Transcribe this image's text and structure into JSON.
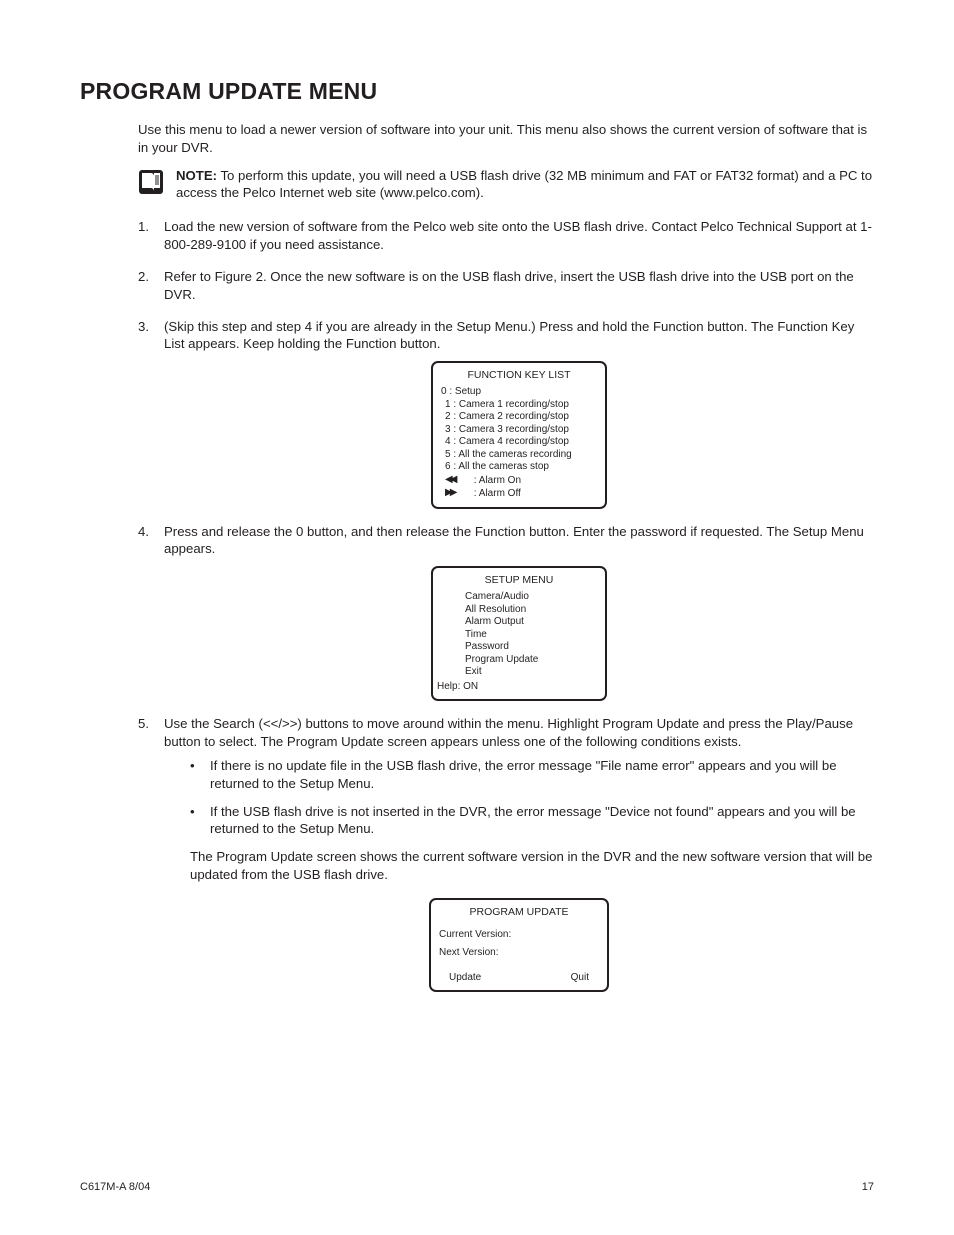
{
  "heading": "PROGRAM UPDATE MENU",
  "intro": "Use this menu to load a newer version of software into your unit. This menu also shows the current version of software that is in your DVR.",
  "note": {
    "label": "NOTE:",
    "text": "  To perform this update, you will need a USB flash drive (32 MB minimum and FAT or FAT32 format) and a PC to access the Pelco Internet web site (www.pelco.com)."
  },
  "steps": {
    "s1": "Load the new version of software from the Pelco web site onto the USB flash drive. Contact Pelco Technical Support at 1-800-289-9100 if you need assistance.",
    "s2": "Refer to Figure 2. Once the new software is on the USB flash drive, insert the USB flash drive into the USB port on the DVR.",
    "s3": "(Skip this step and step 4 if you are already in the Setup Menu.) Press and hold the Function button. The Function Key List appears. Keep holding the Function button.",
    "s4": "Press and release the 0 button, and then release the Function button. Enter the password if requested. The Setup Menu appears.",
    "s5": "Use the Search (<</>>) buttons to move around within the menu. Highlight Program Update and press the Play/Pause button to select. The Program Update screen appears unless one of the following conditions exists.",
    "s5_b1": "If there is no update file in the USB flash drive, the error message \"File name error\" appears and you will be returned to the Setup Menu.",
    "s5_b2": "If the USB flash drive is not inserted in the DVR, the error message \"Device not found\" appears and you will be returned to the Setup Menu.",
    "s5_after": "The Program Update screen shows the current software version in the DVR and the new software version that will be updated from the USB flash drive."
  },
  "panel1": {
    "title": "FUNCTION KEY LIST",
    "l0": "0 : Setup",
    "l1": "1 : Camera 1 recording/stop",
    "l2": "2 : Camera 2 recording/stop",
    "l3": "3 : Camera 3 recording/stop",
    "l4": "4 : Camera 4 recording/stop",
    "l5": "5 : All the cameras recording",
    "l6": "6 : All the cameras stop",
    "l7": " : Alarm On",
    "l8": " : Alarm Off"
  },
  "panel2": {
    "title": "SETUP MENU",
    "l0": "Camera/Audio",
    "l1": "All Resolution",
    "l2": "Alarm Output",
    "l3": "Time",
    "l4": "Password",
    "l5": "Program Update",
    "l6": "Exit",
    "help": "Help: ON"
  },
  "panel3": {
    "title": "PROGRAM UPDATE",
    "l0": "Current Version:",
    "l1": "Next Version:",
    "b0": "Update",
    "b1": "Quit"
  },
  "footer": {
    "left": "C617M-A 8/04",
    "right": "17"
  }
}
